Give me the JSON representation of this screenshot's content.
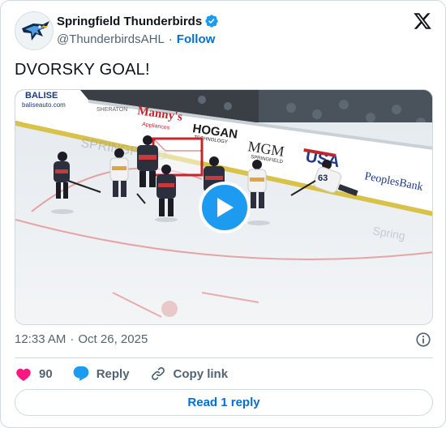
{
  "author": {
    "name": "Springfield Thunderbirds",
    "handle": "@ThunderbirdsAHL",
    "separator": "·",
    "follow_label": "Follow"
  },
  "tweet": {
    "text": "DVORSKY GOAL!"
  },
  "media": {
    "type": "video",
    "board_ads": [
      "BALISE",
      "baliseauto.com",
      "SHERATON",
      "Manny's Appliances",
      "HOGAN TECHNOLOGY",
      "MGM SPRINGFIELD",
      "USA",
      "PeoplesBank"
    ],
    "jersey_number": "63"
  },
  "meta": {
    "time": "12:33 AM",
    "separator": "·",
    "date": "Oct 26, 2025"
  },
  "actions": {
    "likes": "90",
    "reply_label": "Reply",
    "copy_label": "Copy link"
  },
  "read_replies_label": "Read 1 reply",
  "colors": {
    "link": "#006fd6",
    "play": "#1d9bf0",
    "heart": "#f91880",
    "text_secondary": "#536471"
  },
  "icons": {
    "verified": "verified-badge-icon",
    "platform": "x-logo-icon",
    "play": "play-icon",
    "info": "info-icon",
    "like": "heart-icon",
    "reply": "reply-bubble-icon",
    "copy": "link-icon"
  }
}
